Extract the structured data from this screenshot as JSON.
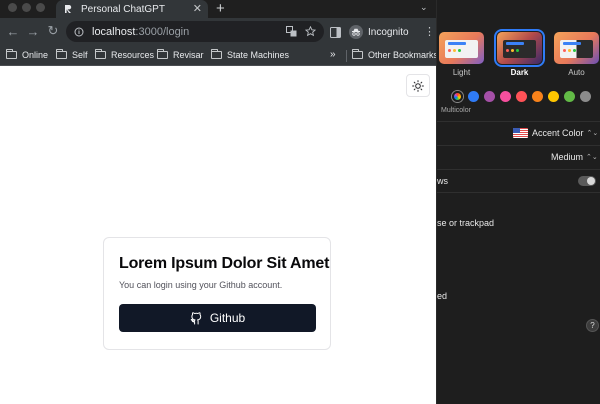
{
  "browser": {
    "tab": {
      "title": "Personal ChatGPT",
      "close_glyph": "✕",
      "favicon": "r-logo-icon"
    },
    "new_tab_glyph": "+",
    "tab_menu_glyph": "⌄",
    "nav": {
      "back": "←",
      "forward": "→",
      "reload": "↻"
    },
    "url_host": "localhost",
    "url_path": ":3000/login",
    "incognito_label": "Incognito",
    "menu_glyph": "⋮",
    "bookmarks": [
      {
        "label": "Online"
      },
      {
        "label": "Self"
      },
      {
        "label": "Resources"
      },
      {
        "label": "Revisar"
      },
      {
        "label": "State Machines"
      }
    ],
    "bookmarks_overflow": "»",
    "other_bookmarks": "Other Bookmarks"
  },
  "page": {
    "card_title": "Lorem Ipsum Dolor Sit Amet",
    "card_subtitle": "You can login using your Github account.",
    "github_button": "Github"
  },
  "settings": {
    "appearance_options": [
      {
        "label": "Light",
        "selected": false
      },
      {
        "label": "Dark",
        "selected": true
      },
      {
        "label": "Auto",
        "selected": false
      }
    ],
    "accent_swatches": [
      "multicolor",
      "#2f7bf6",
      "#a550a7",
      "#f74f9e",
      "#ff5257",
      "#f7821b",
      "#ffc600",
      "#62ba46",
      "#8c8c8c"
    ],
    "multicolor_label": "Multicolor",
    "accent_color_label": "Accent Color",
    "accent_value_glyph": "⌃⌄",
    "highlight_size_value": "Medium",
    "highlight_value_glyph": "⌃⌄",
    "window_setting_tail": "ws",
    "trackpad_setting_tail": "se or trackpad",
    "ed_setting_tail": "ed",
    "help_glyph": "?",
    "colors": {
      "selection_outline": "#2f7bf6",
      "panel_bg": "#1e1e1e"
    }
  }
}
